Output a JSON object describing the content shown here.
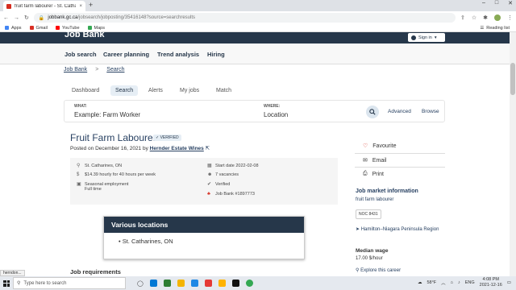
{
  "browser": {
    "tab_title": "fruit farm labourer - St. Catharines...",
    "tab_close": "×",
    "new_tab": "+",
    "url_host": "jobbank.gc.ca",
    "url_path": "/jobsearch/jobposting/35416148?source=searchresults",
    "window_controls": [
      "–",
      "□",
      "✕"
    ],
    "bookmarks": [
      {
        "label": "Apps",
        "color": "#4285f4"
      },
      {
        "label": "Gmail",
        "color": "#d93025"
      },
      {
        "label": "YouTube",
        "color": "#ff0000"
      },
      {
        "label": "Maps",
        "color": "#34a853"
      }
    ],
    "reading_list": "Reading list",
    "status_url": "herndon..."
  },
  "site": {
    "title": "Job Bank",
    "signin_label": "Sign in",
    "nav": [
      "Job search",
      "Career planning",
      "Trend analysis",
      "Hiring"
    ],
    "breadcrumb": [
      "Job Bank",
      "Search"
    ],
    "breadcrumb_sep": ">",
    "subnav": [
      "Dashboard",
      "Search",
      "Alerts",
      "My jobs",
      "Match"
    ]
  },
  "search": {
    "what_label": "WHAT:",
    "what_value": "Example: Farm Worker",
    "where_label": "WHERE:",
    "where_value": "Location",
    "advanced": "Advanced",
    "browse": "Browse"
  },
  "job": {
    "title": "Fruit Farm Labourer",
    "verified": "✓ VERIFIED",
    "posted_prefix": "Posted on December 16, 2021 by ",
    "employer": "Hernder Estate Wines",
    "location": "St. Catharines, ON",
    "wage": "$14.39 hourly for 40 hours per week",
    "employment_type": "Seasonal employment",
    "employment_time": "Full time",
    "start_date": "Start date 2022-02-08",
    "vacancies": "7 vacancies",
    "verified_text": "Verified",
    "job_bank_id": "Job Bank #1897773",
    "various_locations_title": "Various locations",
    "various_locations": [
      "St. Catharines, ON"
    ],
    "requirements_heading": "Job requirements"
  },
  "sidebar": {
    "favourite": "Favourite",
    "email": "Email",
    "print": "Print",
    "market_title": "Job market information",
    "market_sub": "fruit farm labourer",
    "noc": "NOC 8431",
    "region": "Hamilton–Niagara Peninsula Region",
    "median_wage_label": "Median wage",
    "median_wage_value": "17.00 $/hour",
    "explore": "Explore this career"
  },
  "taskbar": {
    "search_placeholder": "Type here to search",
    "weather": "58°F",
    "lang": "ENG",
    "time": "4:08 PM",
    "date": "2021-12-16",
    "apps": [
      "#0078d4",
      "#2e7d32",
      "#f4b400",
      "#1e88e5",
      "#e53935",
      "#ffb300",
      "#111111",
      "#34a853"
    ]
  }
}
